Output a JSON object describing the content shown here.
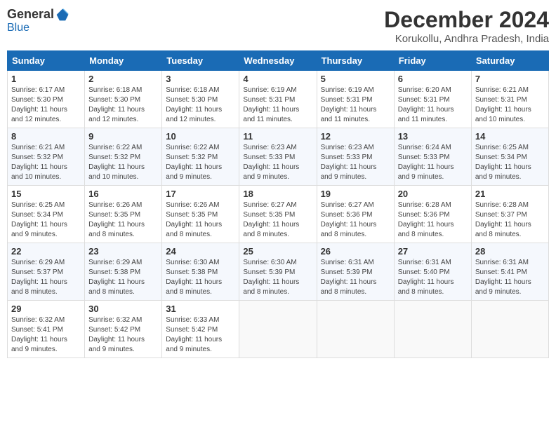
{
  "header": {
    "logo_general": "General",
    "logo_blue": "Blue",
    "title": "December 2024",
    "location": "Korukollu, Andhra Pradesh, India"
  },
  "columns": [
    "Sunday",
    "Monday",
    "Tuesday",
    "Wednesday",
    "Thursday",
    "Friday",
    "Saturday"
  ],
  "weeks": [
    [
      {
        "day": "1",
        "info": "Sunrise: 6:17 AM\nSunset: 5:30 PM\nDaylight: 11 hours\nand 12 minutes."
      },
      {
        "day": "2",
        "info": "Sunrise: 6:18 AM\nSunset: 5:30 PM\nDaylight: 11 hours\nand 12 minutes."
      },
      {
        "day": "3",
        "info": "Sunrise: 6:18 AM\nSunset: 5:30 PM\nDaylight: 11 hours\nand 12 minutes."
      },
      {
        "day": "4",
        "info": "Sunrise: 6:19 AM\nSunset: 5:31 PM\nDaylight: 11 hours\nand 11 minutes."
      },
      {
        "day": "5",
        "info": "Sunrise: 6:19 AM\nSunset: 5:31 PM\nDaylight: 11 hours\nand 11 minutes."
      },
      {
        "day": "6",
        "info": "Sunrise: 6:20 AM\nSunset: 5:31 PM\nDaylight: 11 hours\nand 11 minutes."
      },
      {
        "day": "7",
        "info": "Sunrise: 6:21 AM\nSunset: 5:31 PM\nDaylight: 11 hours\nand 10 minutes."
      }
    ],
    [
      {
        "day": "8",
        "info": "Sunrise: 6:21 AM\nSunset: 5:32 PM\nDaylight: 11 hours\nand 10 minutes."
      },
      {
        "day": "9",
        "info": "Sunrise: 6:22 AM\nSunset: 5:32 PM\nDaylight: 11 hours\nand 10 minutes."
      },
      {
        "day": "10",
        "info": "Sunrise: 6:22 AM\nSunset: 5:32 PM\nDaylight: 11 hours\nand 9 minutes."
      },
      {
        "day": "11",
        "info": "Sunrise: 6:23 AM\nSunset: 5:33 PM\nDaylight: 11 hours\nand 9 minutes."
      },
      {
        "day": "12",
        "info": "Sunrise: 6:23 AM\nSunset: 5:33 PM\nDaylight: 11 hours\nand 9 minutes."
      },
      {
        "day": "13",
        "info": "Sunrise: 6:24 AM\nSunset: 5:33 PM\nDaylight: 11 hours\nand 9 minutes."
      },
      {
        "day": "14",
        "info": "Sunrise: 6:25 AM\nSunset: 5:34 PM\nDaylight: 11 hours\nand 9 minutes."
      }
    ],
    [
      {
        "day": "15",
        "info": "Sunrise: 6:25 AM\nSunset: 5:34 PM\nDaylight: 11 hours\nand 9 minutes."
      },
      {
        "day": "16",
        "info": "Sunrise: 6:26 AM\nSunset: 5:35 PM\nDaylight: 11 hours\nand 8 minutes."
      },
      {
        "day": "17",
        "info": "Sunrise: 6:26 AM\nSunset: 5:35 PM\nDaylight: 11 hours\nand 8 minutes."
      },
      {
        "day": "18",
        "info": "Sunrise: 6:27 AM\nSunset: 5:35 PM\nDaylight: 11 hours\nand 8 minutes."
      },
      {
        "day": "19",
        "info": "Sunrise: 6:27 AM\nSunset: 5:36 PM\nDaylight: 11 hours\nand 8 minutes."
      },
      {
        "day": "20",
        "info": "Sunrise: 6:28 AM\nSunset: 5:36 PM\nDaylight: 11 hours\nand 8 minutes."
      },
      {
        "day": "21",
        "info": "Sunrise: 6:28 AM\nSunset: 5:37 PM\nDaylight: 11 hours\nand 8 minutes."
      }
    ],
    [
      {
        "day": "22",
        "info": "Sunrise: 6:29 AM\nSunset: 5:37 PM\nDaylight: 11 hours\nand 8 minutes."
      },
      {
        "day": "23",
        "info": "Sunrise: 6:29 AM\nSunset: 5:38 PM\nDaylight: 11 hours\nand 8 minutes."
      },
      {
        "day": "24",
        "info": "Sunrise: 6:30 AM\nSunset: 5:38 PM\nDaylight: 11 hours\nand 8 minutes."
      },
      {
        "day": "25",
        "info": "Sunrise: 6:30 AM\nSunset: 5:39 PM\nDaylight: 11 hours\nand 8 minutes."
      },
      {
        "day": "26",
        "info": "Sunrise: 6:31 AM\nSunset: 5:39 PM\nDaylight: 11 hours\nand 8 minutes."
      },
      {
        "day": "27",
        "info": "Sunrise: 6:31 AM\nSunset: 5:40 PM\nDaylight: 11 hours\nand 8 minutes."
      },
      {
        "day": "28",
        "info": "Sunrise: 6:31 AM\nSunset: 5:41 PM\nDaylight: 11 hours\nand 9 minutes."
      }
    ],
    [
      {
        "day": "29",
        "info": "Sunrise: 6:32 AM\nSunset: 5:41 PM\nDaylight: 11 hours\nand 9 minutes."
      },
      {
        "day": "30",
        "info": "Sunrise: 6:32 AM\nSunset: 5:42 PM\nDaylight: 11 hours\nand 9 minutes."
      },
      {
        "day": "31",
        "info": "Sunrise: 6:33 AM\nSunset: 5:42 PM\nDaylight: 11 hours\nand 9 minutes."
      },
      {
        "day": "",
        "info": ""
      },
      {
        "day": "",
        "info": ""
      },
      {
        "day": "",
        "info": ""
      },
      {
        "day": "",
        "info": ""
      }
    ]
  ]
}
